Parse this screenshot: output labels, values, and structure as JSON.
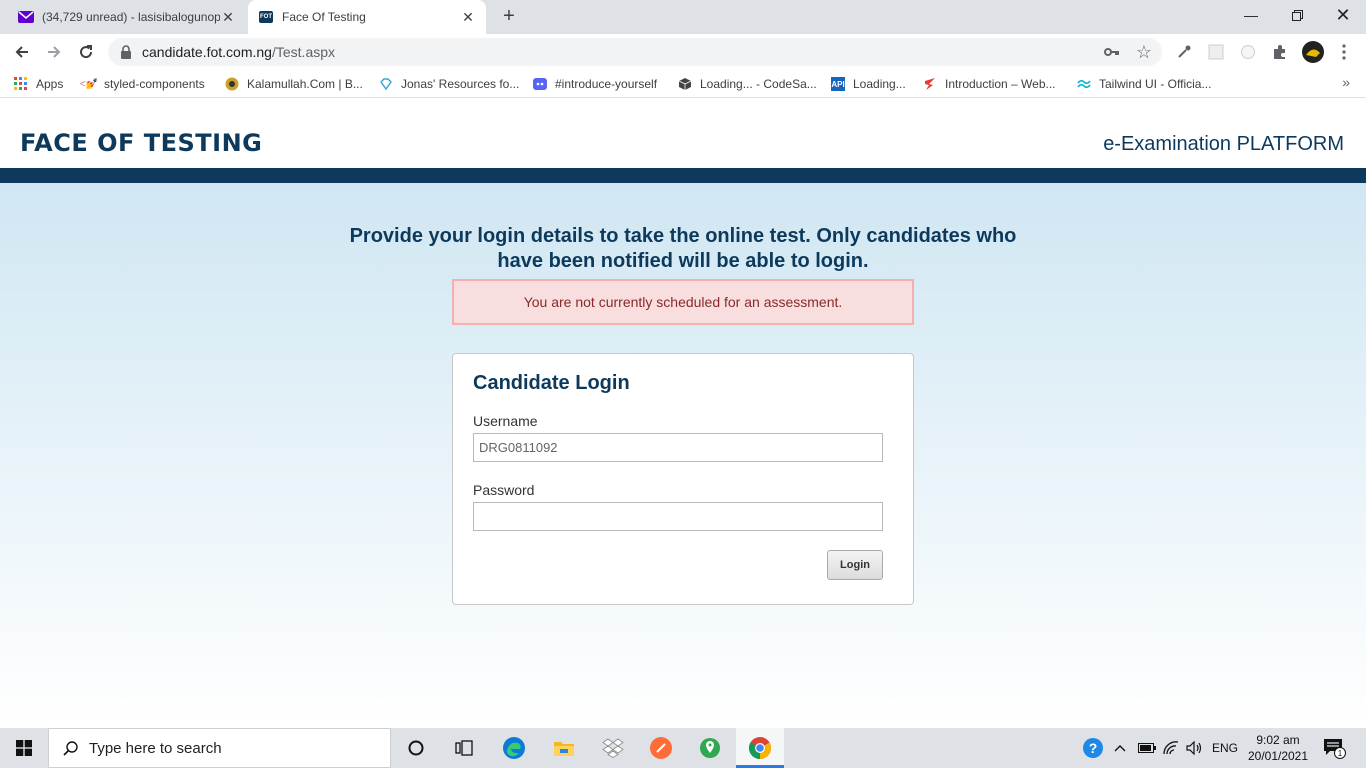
{
  "browser": {
    "tabs": [
      {
        "title": "(34,729 unread) - lasisibalogunop",
        "icon": "yahoo-mail-icon",
        "active": false
      },
      {
        "title": "Face Of Testing",
        "icon": "fot-icon",
        "active": true
      }
    ],
    "fot_favicon_text": "FOT",
    "url_host": "candidate.fot.com.ng",
    "url_path": "/Test.aspx",
    "bookmarks": [
      {
        "label": "Apps",
        "icon": "apps-grid-icon"
      },
      {
        "label": "styled-components",
        "icon": "styled-components-icon"
      },
      {
        "label": "Kalamullah.Com | B...",
        "icon": "kalamullah-icon"
      },
      {
        "label": "Jonas' Resources fo...",
        "icon": "diamond-icon"
      },
      {
        "label": "#introduce-yourself",
        "icon": "discord-icon"
      },
      {
        "label": "Loading... - CodeSa...",
        "icon": "codesandbox-icon"
      },
      {
        "label": "Loading...",
        "icon": "api-icon"
      },
      {
        "label": "Introduction – Web...",
        "icon": "webpack-icon"
      },
      {
        "label": "Tailwind UI - Officia...",
        "icon": "tailwind-icon"
      }
    ],
    "api_badge": "API"
  },
  "site": {
    "brand": "FACE OF TESTING",
    "platform": "e-Examination PLATFORM"
  },
  "main": {
    "headline": "Provide your login details to take the online test. Only candidates who have been notified will be able to login.",
    "alert": "You are not currently scheduled for an assessment.",
    "login": {
      "title": "Candidate Login",
      "username_label": "Username",
      "username_value": "DRG0811092",
      "password_label": "Password",
      "password_value": "",
      "button_label": "Login"
    }
  },
  "taskbar": {
    "search_placeholder": "Type here to search",
    "language": "ENG",
    "time": "9:02 am",
    "date": "20/01/2021",
    "notification_count": "1"
  },
  "colors": {
    "brand_navy": "#0d3a5c",
    "alert_bg": "#f8dede",
    "alert_text": "#8a2a2a"
  }
}
